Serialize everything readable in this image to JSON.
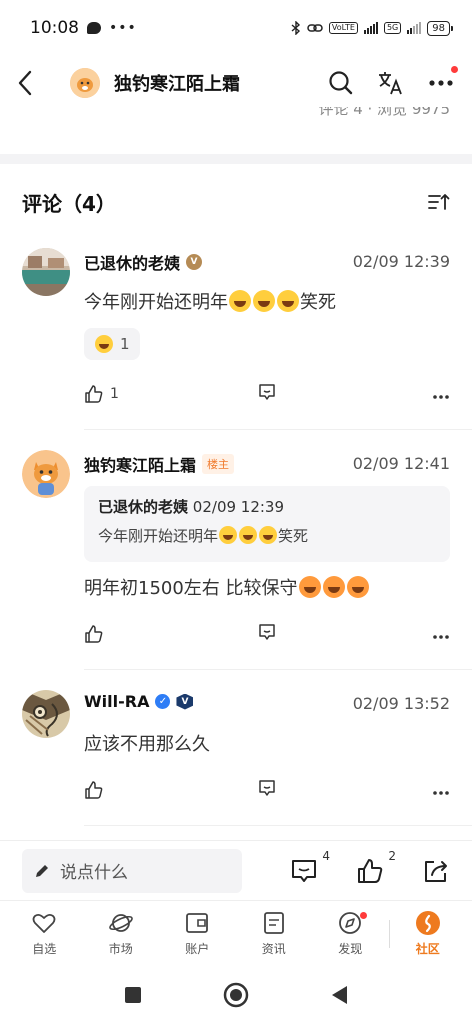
{
  "status_bar": {
    "time": "10:08",
    "dots": "•••",
    "net_tag_1": "VoLTE",
    "net_tag_2": "5G",
    "battery": "98"
  },
  "nav": {
    "title": "独钓寒江陌上霜"
  },
  "stats_partial": "评论 4 · 浏览 9975",
  "comments_section": {
    "title": "评论（4）"
  },
  "comments": [
    {
      "author": "已退休的老姨",
      "time": "02/09 12:39",
      "text": "今年刚开始还明年",
      "text_suffix": "笑死",
      "reaction_count": "1",
      "likes": "1"
    },
    {
      "author": "独钓寒江陌上霜",
      "host_badge": "楼主",
      "time": "02/09 12:41",
      "quote": {
        "author": "已退休的老姨",
        "time": "02/09 12:39",
        "text": "今年刚开始还明年",
        "text_suffix": "笑死"
      },
      "text": "明年初1500左右  比较保守",
      "likes": ""
    },
    {
      "author": "Will-RA",
      "time": "02/09 13:52",
      "text": "应该不用那么久",
      "likes": ""
    }
  ],
  "input_bar": {
    "placeholder": "说点什么",
    "comment_count": "4",
    "like_count": "2"
  },
  "tabs": [
    {
      "label": "自选",
      "icon": "heart-icon"
    },
    {
      "label": "市场",
      "icon": "planet-icon"
    },
    {
      "label": "账户",
      "icon": "wallet-icon"
    },
    {
      "label": "资讯",
      "icon": "news-icon"
    },
    {
      "label": "发现",
      "icon": "compass-icon"
    },
    {
      "label": "社区",
      "icon": "community-icon",
      "active": true
    }
  ],
  "colors": {
    "accent": "#ee7a1f",
    "host_badge": "#f07a2c",
    "red_dot": "#ff3b3b"
  }
}
